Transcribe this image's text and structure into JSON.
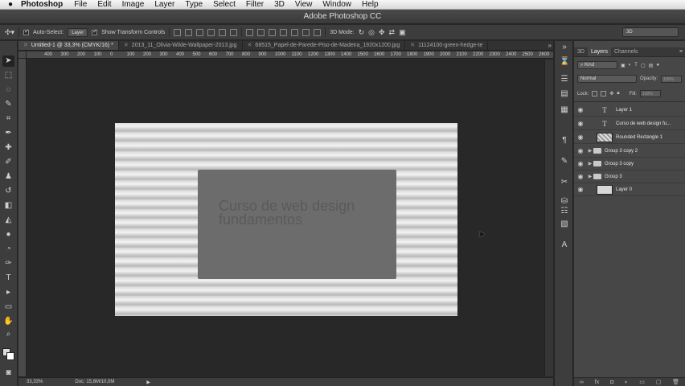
{
  "menubar": {
    "app_name": "Photoshop",
    "menus": [
      "File",
      "Edit",
      "Image",
      "Layer",
      "Type",
      "Select",
      "Filter",
      "3D",
      "View",
      "Window",
      "Help"
    ]
  },
  "window": {
    "title": "Adobe Photoshop CC"
  },
  "options": {
    "auto_select_label": "Auto-Select:",
    "auto_select_value": "Layer",
    "transform_label": "Show Transform Controls",
    "mode_3d_label": "3D Mode:",
    "workspace": "3D"
  },
  "tabs": [
    {
      "label": "Untitled-1 @ 33,3% (CMYK/16) *",
      "active": true
    },
    {
      "label": "2013_11_Olivia-Wilde-Wallpaper-2013.jpg",
      "active": false
    },
    {
      "label": "68515_Papel-de-Parede-Piso-de-Madeira_1920x1200.jpg",
      "active": false
    },
    {
      "label": "11124100-green-hedge-te",
      "active": false
    }
  ],
  "ruler": {
    "ticks": [
      "400",
      "300",
      "200",
      "100",
      "0",
      "100",
      "200",
      "300",
      "400",
      "500",
      "600",
      "700",
      "800",
      "900",
      "1000",
      "1100",
      "1200",
      "1300",
      "1400",
      "1500",
      "1600",
      "1700",
      "1800",
      "1900",
      "2000",
      "2100",
      "2200",
      "2300",
      "2400",
      "2500",
      "2600",
      "2700",
      "2800",
      "2900",
      "3000",
      "3100",
      "3200",
      "3300",
      "3400"
    ]
  },
  "canvas": {
    "heading_line1": "Curso de web design",
    "heading_line2": "fundamentos"
  },
  "status": {
    "zoom": "33,33%",
    "doc": "Doc: 15,8M/10,0M"
  },
  "panel": {
    "tabs": [
      "3D",
      "Layers",
      "Channels"
    ],
    "kind_label": "Kind",
    "blend_mode": "Normal",
    "opacity_label": "Opacity:",
    "opacity_value": "100%",
    "lock_label": "Lock:",
    "fill_label": "Fill:",
    "fill_value": "100%",
    "layers": [
      {
        "name": "Layer 1",
        "type": "text"
      },
      {
        "name": "Curso de web design fu...",
        "type": "text"
      },
      {
        "name": "Rounded Rectangle 1",
        "type": "shape"
      },
      {
        "name": "Group 3 copy 2",
        "type": "group"
      },
      {
        "name": "Group 3 copy",
        "type": "group"
      },
      {
        "name": "Group 3",
        "type": "group"
      },
      {
        "name": "Layer 0",
        "type": "image"
      }
    ]
  }
}
